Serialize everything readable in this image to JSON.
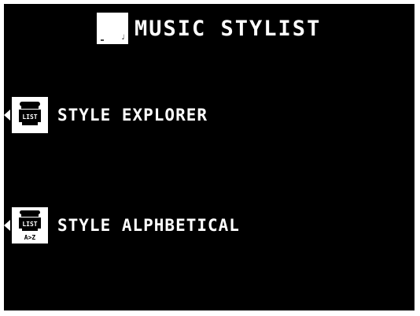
{
  "screen": {
    "title": "MUSIC STYLIST",
    "title_icon": "music-stylist-icon",
    "title_icon_glyph": "♩"
  },
  "menu": {
    "items": [
      {
        "label": "STYLE EXPLORER",
        "icon": "list-box-icon",
        "icon_text": "LIST"
      },
      {
        "label": "STYLE ALPHBETICAL",
        "icon": "list-alphabetical-icon",
        "icon_text": "LIST",
        "icon_subtext": "A>Z"
      }
    ]
  },
  "colors": {
    "background": "#000000",
    "foreground": "#ffffff"
  }
}
